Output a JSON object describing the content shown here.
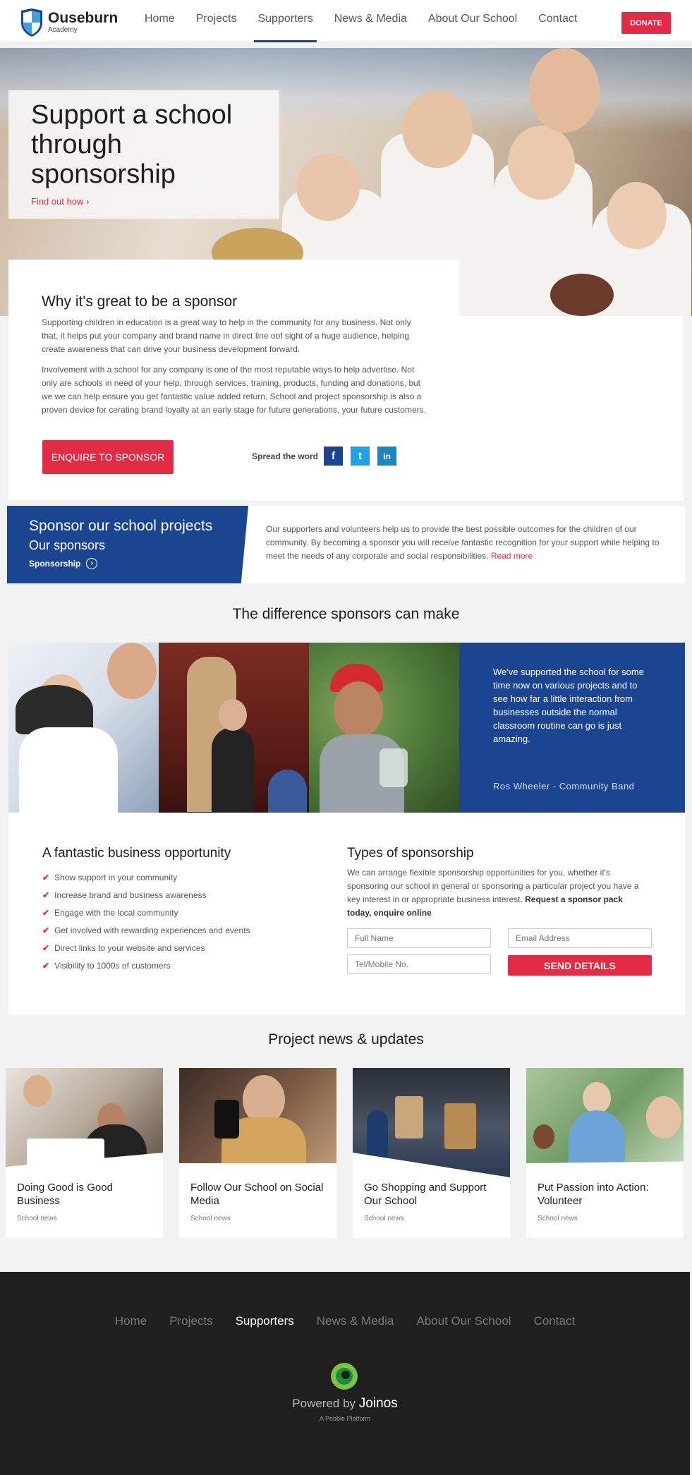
{
  "header": {
    "logo_name": "Ouseburn",
    "logo_sub": "Academy",
    "nav": [
      {
        "label": "Home"
      },
      {
        "label": "Projects"
      },
      {
        "label": "Supporters"
      },
      {
        "label": "News & Media"
      },
      {
        "label": "About Our School"
      },
      {
        "label": "Contact"
      }
    ],
    "active_nav": "Supporters",
    "donate_label": "DONATE"
  },
  "hero": {
    "title": "Support a school through sponsorship",
    "link": "Find out how"
  },
  "why": {
    "heading": "Why it's great to be a sponsor",
    "para1": "Supporting children in education is a great way to help in the community for any business. Not only that, it helps put your company and brand name in direct line oof sight of a huge audience, helping create awareness that can drive your business development forward.",
    "para2": "Involvement with a school for any company is one of the most reputable ways to help advertise. Not only are schools in need of your help, through services, training, products, funding and donations, but we we can help ensure you get fantastic value added return. School and project sponsorship is also a proven device for cerating brand loyalty at an early stage for future generations, your future customers.",
    "button": "ENQUIRE TO SPONSOR",
    "spread": "Spread the word",
    "social": [
      "f",
      "t",
      "in"
    ]
  },
  "banner": {
    "title": "Sponsor our school projects",
    "subtitle": "Our sponsors",
    "link": "Sponsorship",
    "text": "Our supporters and volunteers help us to provide the best possible outcomes for the children of our community. By becoming a sponsor you will receive fantastic recognition for your support while helping to meet the needs of any corporate and social responsibilities.",
    "read_more": "Read more"
  },
  "difference": {
    "heading": "The difference sponsors can make",
    "quote": "We've supported the school for some time now on various projects and to see how far a little interaction from businesses outside the normal classroom routine can go is just amazing.",
    "author": "Ros Wheeler - Community Band"
  },
  "business": {
    "heading": "A fantastic business opportunity",
    "items": [
      "Show support in your community",
      "Increase brand and business awareness",
      "Engage with the local community",
      "Get involved with rewarding experiences and events",
      "Direct links to your website and services",
      "Visibility to 1000s of customers"
    ]
  },
  "types": {
    "heading": "Types of sponsorship",
    "text": "We can arrange flexible sponsorship opportunities for you, whether it's sponsoring our school in general or sponsoring a particular project you have a key interest in or appropriate business interest.",
    "text_bold": "Request a sponsor pack today, enquire online",
    "full_name_placeholder": "Full Name",
    "email_placeholder": "Email Address",
    "phone_placeholder": "Tel/Mobile No.",
    "send": "SEND DETAILS"
  },
  "news": {
    "heading": "Project news & updates",
    "cards": [
      {
        "title": "Doing Good is Good Business",
        "category": "School news"
      },
      {
        "title": "Follow Our School on Social Media",
        "category": "School news"
      },
      {
        "title": "Go Shopping and Support Our School",
        "category": "School news"
      },
      {
        "title": "Put Passion into Action: Volunteer",
        "category": "School news"
      }
    ]
  },
  "footer": {
    "nav": [
      {
        "label": "Home"
      },
      {
        "label": "Projects"
      },
      {
        "label": "Supporters"
      },
      {
        "label": "News & Media"
      },
      {
        "label": "About Our School"
      },
      {
        "label": "Contact"
      }
    ],
    "powered": "Powered by",
    "brand": "Joinos",
    "platform": "A Pebble Platform"
  },
  "colors": {
    "accent_red": "#e32b45",
    "brand_blue": "#1c4591",
    "footer_bg": "#1f1f1f"
  }
}
